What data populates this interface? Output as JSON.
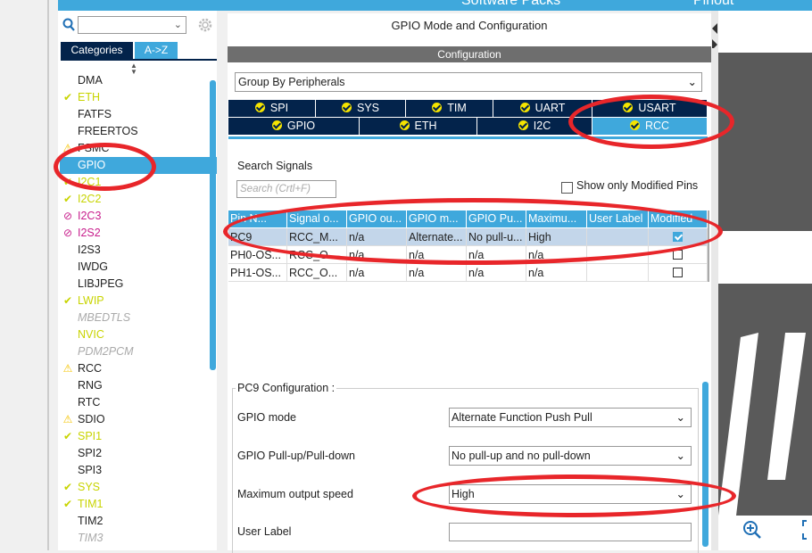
{
  "topbar": {
    "software_packs": "Software Packs",
    "pinout": "Pinout"
  },
  "left": {
    "tabs": {
      "categories": "Categories",
      "az": "A->Z"
    },
    "items": [
      {
        "label": "DMA",
        "status": "none"
      },
      {
        "label": "ETH",
        "status": "ok"
      },
      {
        "label": "FATFS",
        "status": "none"
      },
      {
        "label": "FREERTOS",
        "status": "none"
      },
      {
        "label": "FSMC",
        "status": "warn"
      },
      {
        "label": "GPIO",
        "status": "selected"
      },
      {
        "label": "I2C1",
        "status": "ok"
      },
      {
        "label": "I2C2",
        "status": "ok"
      },
      {
        "label": "I2C3",
        "status": "err"
      },
      {
        "label": "I2S2",
        "status": "err"
      },
      {
        "label": "I2S3",
        "status": "none"
      },
      {
        "label": "IWDG",
        "status": "none"
      },
      {
        "label": "LIBJPEG",
        "status": "none"
      },
      {
        "label": "LWIP",
        "status": "ok"
      },
      {
        "label": "MBEDTLS",
        "status": "disabled"
      },
      {
        "label": "NVIC",
        "status": "ok-plain"
      },
      {
        "label": "PDM2PCM",
        "status": "disabled"
      },
      {
        "label": "RCC",
        "status": "warn"
      },
      {
        "label": "RNG",
        "status": "none"
      },
      {
        "label": "RTC",
        "status": "none"
      },
      {
        "label": "SDIO",
        "status": "warn"
      },
      {
        "label": "SPI1",
        "status": "ok"
      },
      {
        "label": "SPI2",
        "status": "none"
      },
      {
        "label": "SPI3",
        "status": "none"
      },
      {
        "label": "SYS",
        "status": "ok"
      },
      {
        "label": "TIM1",
        "status": "ok"
      },
      {
        "label": "TIM2",
        "status": "none"
      },
      {
        "label": "TIM3",
        "status": "disabled"
      }
    ]
  },
  "center": {
    "title": "GPIO Mode and Configuration",
    "config_bar": "Configuration",
    "group_select": "Group By Peripherals",
    "tabs_row1": [
      "SPI",
      "SYS",
      "TIM",
      "UART",
      "USART"
    ],
    "tabs_row2": [
      "GPIO",
      "ETH",
      "I2C",
      "RCC"
    ],
    "active_tab": "RCC",
    "search_label": "Search Signals",
    "search_placeholder": "Search (Crtl+F)",
    "only_modified": "Show only Modified Pins",
    "table": {
      "headers": [
        "Pin N...",
        "Signal o...",
        "GPIO ou...",
        "GPIO m...",
        "GPIO Pu...",
        "Maximu...",
        "User Label",
        "Modified"
      ],
      "rows": [
        {
          "cells": [
            "PC9",
            "RCC_M...",
            "n/a",
            "Alternate...",
            "No pull-u...",
            "High",
            ""
          ],
          "modified": true
        },
        {
          "cells": [
            "PH0-OS...",
            "RCC_O...",
            "n/a",
            "n/a",
            "n/a",
            "n/a",
            ""
          ],
          "modified": false
        },
        {
          "cells": [
            "PH1-OS...",
            "RCC_O...",
            "n/a",
            "n/a",
            "n/a",
            "n/a",
            ""
          ],
          "modified": false
        }
      ]
    },
    "pc9": {
      "title": "PC9 Configuration :",
      "gpio_mode_label": "GPIO mode",
      "gpio_mode_value": "Alternate Function Push Pull",
      "pull_label": "GPIO Pull-up/Pull-down",
      "pull_value": "No pull-up and no pull-down",
      "speed_label": "Maximum output speed",
      "speed_value": "High",
      "user_label_label": "User Label",
      "user_label_value": ""
    }
  },
  "colors": {
    "accent": "#3fa8dc",
    "dark_navy": "#03234b",
    "annotation_red": "#e8262a"
  }
}
